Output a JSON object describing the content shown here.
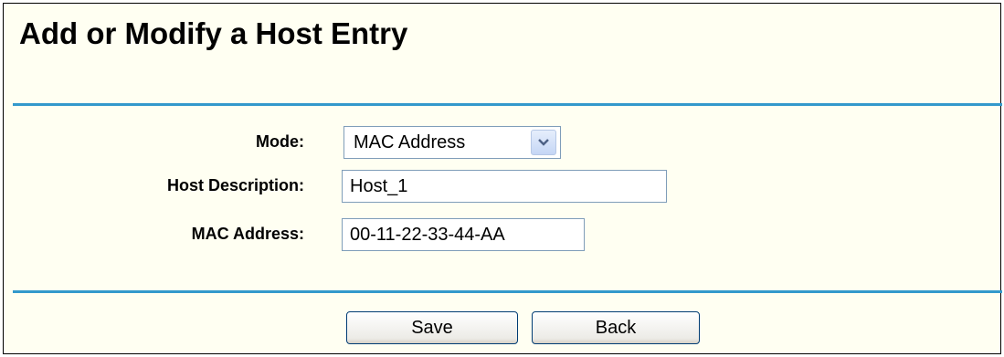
{
  "title": "Add or Modify a Host Entry",
  "form": {
    "mode": {
      "label": "Mode:",
      "value": "MAC Address",
      "options": [
        "MAC Address"
      ]
    },
    "host_description": {
      "label": "Host Description:",
      "value": "Host_1"
    },
    "mac_address": {
      "label": "MAC Address:",
      "value": "00-11-22-33-44-AA"
    }
  },
  "buttons": {
    "save": "Save",
    "back": "Back"
  },
  "colors": {
    "panel_bg": "#fffff2",
    "rule": "#3399cc",
    "field_border": "#7f9db9"
  },
  "icons": {
    "select_arrow": "chevron-down-icon"
  }
}
